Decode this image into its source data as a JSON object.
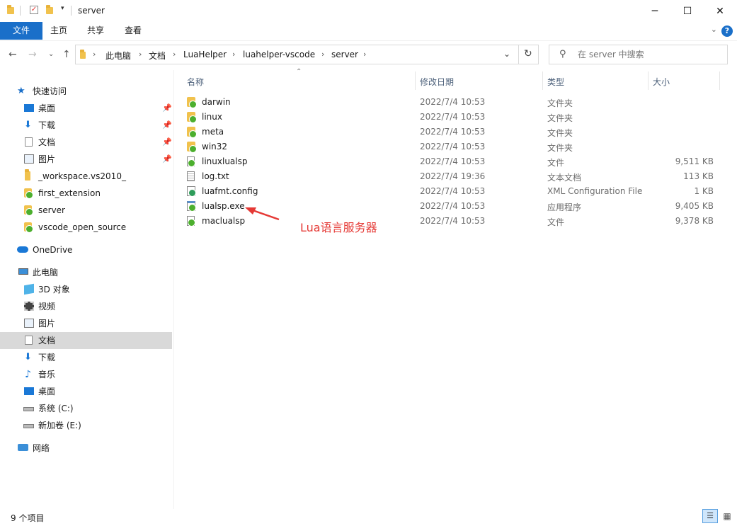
{
  "window": {
    "title": "server",
    "minimize_glyph": "─",
    "maximize_glyph": "☐",
    "close_glyph": "✕"
  },
  "ribbon": {
    "tabs": [
      "文件",
      "主页",
      "共享",
      "查看"
    ],
    "help_glyph": "?"
  },
  "address": {
    "breadcrumbs": [
      "此电脑",
      "文档",
      "LuaHelper",
      "luahelper-vscode",
      "server"
    ]
  },
  "search": {
    "placeholder": "在 server 中搜索"
  },
  "sidebar": {
    "quick_access": "快速访问",
    "quick_items": [
      "桌面",
      "下载",
      "文档",
      "图片",
      "_workspace.vs2010_",
      "first_extension",
      "server",
      "vscode_open_source"
    ],
    "onedrive": "OneDrive",
    "this_pc": "此电脑",
    "pc_items": [
      "3D 对象",
      "视频",
      "图片",
      "文档",
      "下载",
      "音乐",
      "桌面",
      "系统 (C:)",
      "新加卷 (E:)"
    ],
    "network": "网络"
  },
  "columns": {
    "name": "名称",
    "modified": "修改日期",
    "type": "类型",
    "size": "大小"
  },
  "files": [
    {
      "name": "darwin",
      "modified": "2022/7/4 10:53",
      "type": "文件夹",
      "size": "",
      "icon": "vscode-folder-icon"
    },
    {
      "name": "linux",
      "modified": "2022/7/4 10:53",
      "type": "文件夹",
      "size": "",
      "icon": "vscode-folder-icon"
    },
    {
      "name": "meta",
      "modified": "2022/7/4 10:53",
      "type": "文件夹",
      "size": "",
      "icon": "vscode-folder-icon"
    },
    {
      "name": "win32",
      "modified": "2022/7/4 10:53",
      "type": "文件夹",
      "size": "",
      "icon": "vscode-folder-icon"
    },
    {
      "name": "linuxlualsp",
      "modified": "2022/7/4 10:53",
      "type": "文件",
      "size": "9,511 KB",
      "icon": "vscode-file-icon"
    },
    {
      "name": "log.txt",
      "modified": "2022/7/4 19:36",
      "type": "文本文档",
      "size": "113 KB",
      "icon": "text-file-icon"
    },
    {
      "name": "luafmt.config",
      "modified": "2022/7/4 10:53",
      "type": "XML Configuration File",
      "size": "1 KB",
      "icon": "config-file-icon"
    },
    {
      "name": "lualsp.exe",
      "modified": "2022/7/4 10:53",
      "type": "应用程序",
      "size": "9,405 KB",
      "icon": "exe-file-icon"
    },
    {
      "name": "maclualsp",
      "modified": "2022/7/4 10:53",
      "type": "文件",
      "size": "9,378 KB",
      "icon": "vscode-file-icon"
    }
  ],
  "annotation": {
    "text": "Lua语言服务器",
    "color": "#e53935"
  },
  "status": {
    "item_count": "9 个项目"
  },
  "colors": {
    "accent": "#1a6fc9",
    "selected": "#d9d9d9",
    "folder": "#f1c24d"
  }
}
